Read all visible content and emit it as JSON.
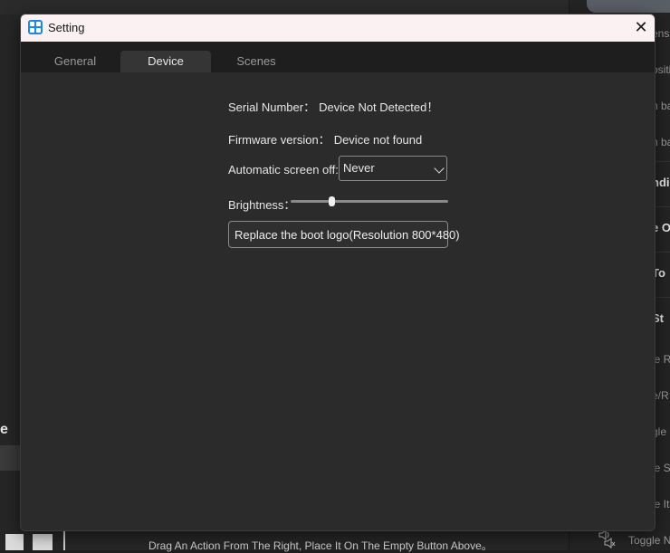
{
  "background": {
    "right_items": [
      "ensh",
      "ositio",
      "n ba",
      "n ba",
      "ndi",
      "e O",
      "To",
      "St",
      "le R",
      "e/R",
      "gle S",
      "le S",
      "le It",
      "Toggle N"
    ],
    "left_heading": "e",
    "bottom_hint": "Drag An Action From The Right, Place It On The Empty Button Above。"
  },
  "dialog": {
    "title": "Setting",
    "tabs": [
      {
        "label": "General",
        "active": false
      },
      {
        "label": "Device",
        "active": true
      },
      {
        "label": "Scenes",
        "active": false
      }
    ],
    "serial": {
      "label": "Serial Number：",
      "value": "Device Not Detected！"
    },
    "firmware": {
      "label": "Firmware version：",
      "value": "Device not found"
    },
    "screen_off": {
      "label": "Automatic screen off:",
      "selected": "Never"
    },
    "brightness": {
      "label": "Brightness：",
      "level_percent": 26
    },
    "boot_logo_button": "Replace the boot logo(Resolution 800*480)"
  },
  "icons": [
    "app-icon",
    "close-icon",
    "chevron-down-icon",
    "speaker-icon",
    "mute-icon"
  ],
  "colors": {
    "titlebar": "#fbf1f3",
    "accent": "#1e88e5",
    "dialog_bg": "#2b2b2b"
  }
}
